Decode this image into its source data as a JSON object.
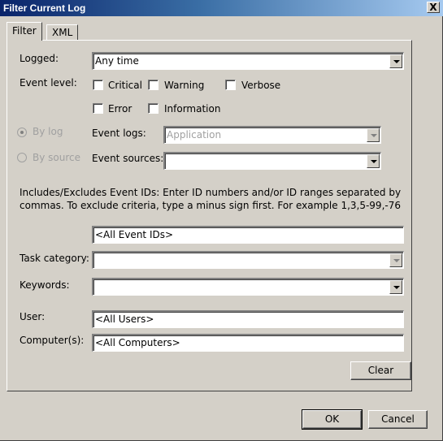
{
  "window": {
    "title": "Filter Current Log",
    "close_label": "X"
  },
  "tabs": [
    {
      "label": "Filter",
      "active": true
    },
    {
      "label": "XML",
      "active": false
    }
  ],
  "filter": {
    "logged": {
      "label": "Logged:",
      "value": "Any time"
    },
    "event_level": {
      "label": "Event level:",
      "options": [
        {
          "label": "Critical",
          "checked": false
        },
        {
          "label": "Warning",
          "checked": false
        },
        {
          "label": "Verbose",
          "checked": false
        },
        {
          "label": "Error",
          "checked": false
        },
        {
          "label": "Information",
          "checked": false
        }
      ]
    },
    "by_log": {
      "label": "By log",
      "selected": true,
      "enabled": false
    },
    "by_source": {
      "label": "By source",
      "selected": false,
      "enabled": false
    },
    "event_logs": {
      "label": "Event logs:",
      "value": "Application",
      "enabled": false
    },
    "event_sources": {
      "label": "Event sources:",
      "value": ""
    },
    "event_ids": {
      "description": "Includes/Excludes Event IDs: Enter ID numbers and/or ID ranges separated by commas. To exclude criteria, type a minus sign first. For example 1,3,5-99,-76",
      "value": "<All Event IDs>"
    },
    "task_category": {
      "label": "Task category:",
      "value": "",
      "enabled": false
    },
    "keywords": {
      "label": "Keywords:",
      "value": ""
    },
    "user": {
      "label": "User:",
      "value": "<All Users>"
    },
    "computers": {
      "label": "Computer(s):",
      "value": "<All Computers>"
    },
    "clear_label": "Clear"
  },
  "footer": {
    "ok_label": "OK",
    "cancel_label": "Cancel"
  }
}
